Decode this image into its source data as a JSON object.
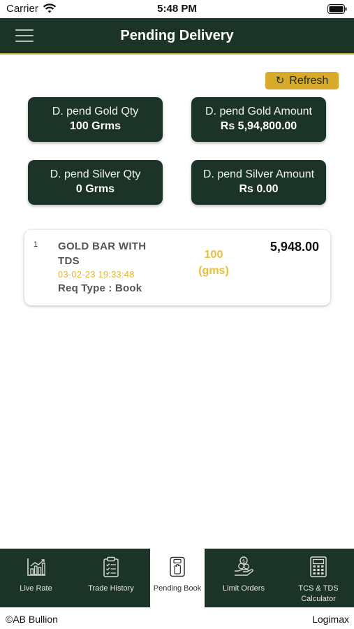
{
  "status_bar": {
    "carrier": "Carrier",
    "time": "5:48 PM"
  },
  "header": {
    "title": "Pending Delivery"
  },
  "refresh": {
    "label": "Refresh"
  },
  "summary": [
    {
      "label": "D. pend Gold Qty",
      "value": "100 Grms"
    },
    {
      "label": "D. pend Gold Amount",
      "value": "Rs 5,94,800.00"
    },
    {
      "label": "D. pend Silver Qty",
      "value": "0 Grms"
    },
    {
      "label": "D. pend Silver Amount",
      "value": "Rs 0.00"
    }
  ],
  "orders": [
    {
      "index": "1",
      "name": "GOLD BAR WITH TDS",
      "date": "03-02-23 19:33:48",
      "req_type": "Req Type : Book",
      "qty": "100",
      "qty_unit": "(gms)",
      "amount": "5,948.00"
    }
  ],
  "tabs": [
    {
      "label": "Live Rate",
      "icon": "chart-icon"
    },
    {
      "label": "Trade History",
      "icon": "clipboard-icon"
    },
    {
      "label": "Pending Book",
      "icon": "hand-card-icon"
    },
    {
      "label": "Limit Orders",
      "icon": "coins-hand-icon"
    },
    {
      "label": "TCS & TDS Calculator",
      "icon": "calculator-icon"
    }
  ],
  "footer": {
    "copyright": "©AB Bullion",
    "brand": "Logimax"
  },
  "colors": {
    "primary": "#1c3328",
    "accent": "#d9aa2a",
    "highlight": "#e8be3c"
  }
}
